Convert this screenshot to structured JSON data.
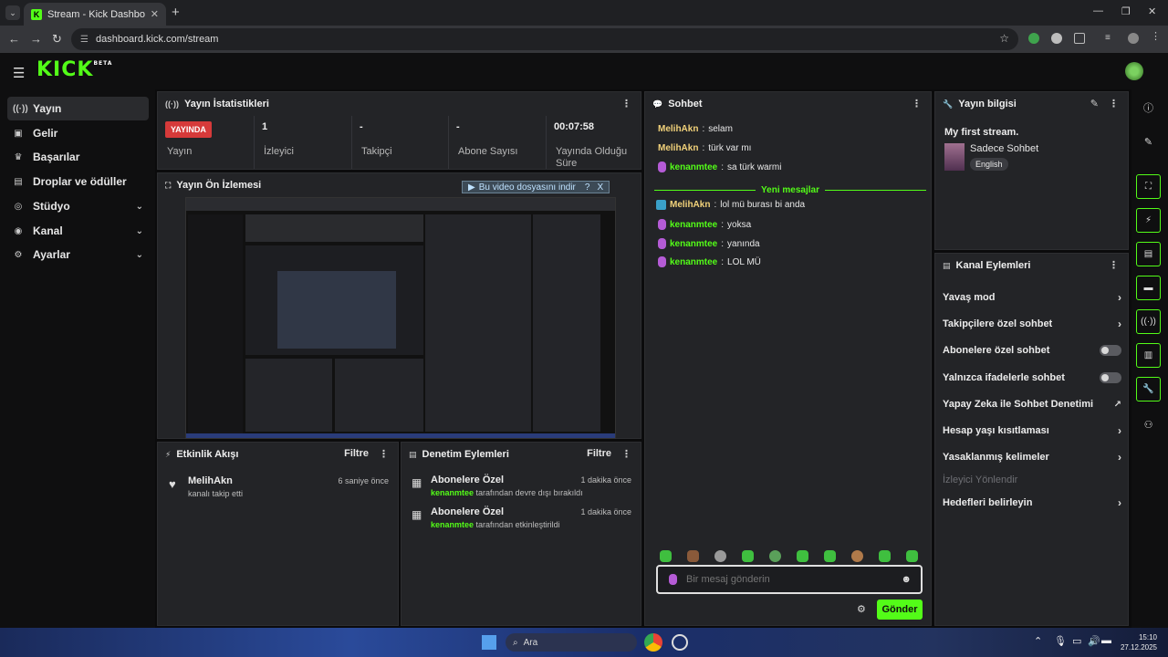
{
  "browser": {
    "tab_title": "Stream - Kick Dashboard",
    "url": "dashboard.kick.com/stream"
  },
  "app": {
    "logo": "KICK",
    "logo_sup": "BETA"
  },
  "sidebar": {
    "items": [
      {
        "label": "Yayın",
        "icon": "broadcast-icon"
      },
      {
        "label": "Gelir",
        "icon": "wallet-icon"
      },
      {
        "label": "Başarılar",
        "icon": "trophy-icon"
      },
      {
        "label": "Droplar ve ödüller",
        "icon": "drops-icon"
      },
      {
        "label": "Stüdyo",
        "icon": "studio-icon"
      },
      {
        "label": "Kanal",
        "icon": "channel-icon"
      },
      {
        "label": "Ayarlar",
        "icon": "gear-icon"
      }
    ]
  },
  "stats": {
    "title": "Yayın İstatistikleri",
    "live_badge": "YAYINDA",
    "cells": [
      {
        "value": "",
        "label": "Yayın"
      },
      {
        "value": "1",
        "label": "İzleyici"
      },
      {
        "value": "-",
        "label": "Takipçi"
      },
      {
        "value": "-",
        "label": "Abone Sayısı"
      },
      {
        "value": "00:07:58",
        "label": "Yayında Olduğu Süre"
      }
    ]
  },
  "preview": {
    "title": "Yayın Ön İzlemesi",
    "download_banner": "Bu video dosyasını indir",
    "download_help": "?",
    "download_close": "X"
  },
  "chat": {
    "title": "Sohbet",
    "messages": [
      {
        "user": "MelihAkn",
        "text": "selam",
        "color": "#f2d27a"
      },
      {
        "user": "MelihAkn",
        "text": "türk var mı",
        "color": "#f2d27a"
      },
      {
        "user": "kenanmtee",
        "text": "sa türk warmi",
        "color": "#53fc18"
      }
    ],
    "new_messages_label": "Yeni mesajlar",
    "new_messages": [
      {
        "user": "MelihAkn",
        "text": "lol mü burası bi anda",
        "color": "#f2d27a"
      },
      {
        "user": "kenanmtee",
        "text": "yoksa",
        "color": "#53fc18"
      },
      {
        "user": "kenanmtee",
        "text": "yanında",
        "color": "#53fc18"
      },
      {
        "user": "kenanmtee",
        "text": "LOL MÜ",
        "color": "#53fc18"
      }
    ],
    "input_placeholder": "Bir mesaj gönderin",
    "send_label": "Gönder"
  },
  "stream_info": {
    "title": "Yayın bilgisi",
    "stream_title": "My first stream.",
    "category": "Sadece Sohbet",
    "language": "English"
  },
  "channel_actions": {
    "title": "Kanal Eylemleri",
    "items": [
      {
        "label": "Yavaş mod",
        "type": "chevron"
      },
      {
        "label": "Takipçilere özel sohbet",
        "type": "chevron"
      },
      {
        "label": "Abonelere özel sohbet",
        "type": "toggle"
      },
      {
        "label": "Yalnızca ifadelerle sohbet",
        "type": "toggle"
      },
      {
        "label": "Yapay Zeka ile Sohbet Denetimi",
        "type": "external"
      },
      {
        "label": "Hesap yaşı kısıtlaması",
        "type": "chevron"
      },
      {
        "label": "Yasaklanmış kelimeler",
        "type": "chevron"
      },
      {
        "label": "İzleyici Yönlendir",
        "type": "disabled"
      },
      {
        "label": "Hedefleri belirleyin",
        "type": "chevron"
      }
    ]
  },
  "activity": {
    "title": "Etkinlik Akışı",
    "filter": "Filtre",
    "items": [
      {
        "name": "MelihAkn",
        "desc": "kanalı takip etti",
        "time": "6 saniye önce"
      }
    ]
  },
  "moderation": {
    "title": "Denetim Eylemleri",
    "filter": "Filtre",
    "items": [
      {
        "title": "Abonelere Özel",
        "user": "kenanmtee",
        "desc": "tarafından devre dışı bırakıldı",
        "time": "1 dakika önce"
      },
      {
        "title": "Abonelere Özel",
        "user": "kenanmtee",
        "desc": "tarafından etkinleştirildi",
        "time": "1 dakika önce"
      }
    ]
  },
  "taskbar": {
    "search": "Ara",
    "time": "15:10",
    "date": "27.12.2025"
  },
  "colors": {
    "accent": "#53fc18",
    "live": "#d63a3a"
  }
}
